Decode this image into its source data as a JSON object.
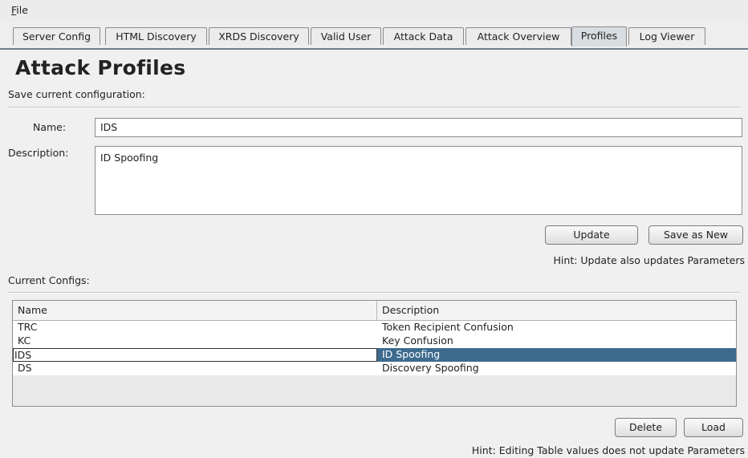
{
  "menu": {
    "file_mnemonic": "F",
    "file_rest": "ile"
  },
  "tabs": [
    {
      "label": "Server Config",
      "active": false
    },
    {
      "label": "HTML Discovery",
      "active": false
    },
    {
      "label": "XRDS Discovery",
      "active": false
    },
    {
      "label": "Valid User",
      "active": false
    },
    {
      "label": "Attack Data",
      "active": false
    },
    {
      "label": "Attack Overview",
      "active": false
    },
    {
      "label": "Profiles",
      "active": true
    },
    {
      "label": "Log Viewer",
      "active": false
    }
  ],
  "page": {
    "title": "Attack Profiles",
    "save_heading": "Save current configuration:",
    "name_label": "Name:",
    "name_value": "IDS",
    "description_label": "Description:",
    "description_value": "ID Spoofing",
    "update_button": "Update",
    "save_new_button": "Save as New",
    "update_hint": "Hint: Update also updates Parameters",
    "current_configs_heading": "Current Configs:",
    "delete_button": "Delete",
    "load_button": "Load",
    "table_hint": "Hint: Editing Table values does not update Parameters"
  },
  "table": {
    "columns": [
      "Name",
      "Description"
    ],
    "rows": [
      {
        "name": "TRC",
        "description": "Token Recipient Confusion",
        "selected": false
      },
      {
        "name": "KC",
        "description": "Key Confusion",
        "selected": false
      },
      {
        "name": "IDS",
        "description": "ID Spoofing",
        "selected": true
      },
      {
        "name": "DS",
        "description": "Discovery Spoofing",
        "selected": false
      }
    ]
  },
  "colors": {
    "selection": "#3d6b8e",
    "tab_active": "#d8dde2",
    "tab_underline": "#6e7f8c"
  }
}
